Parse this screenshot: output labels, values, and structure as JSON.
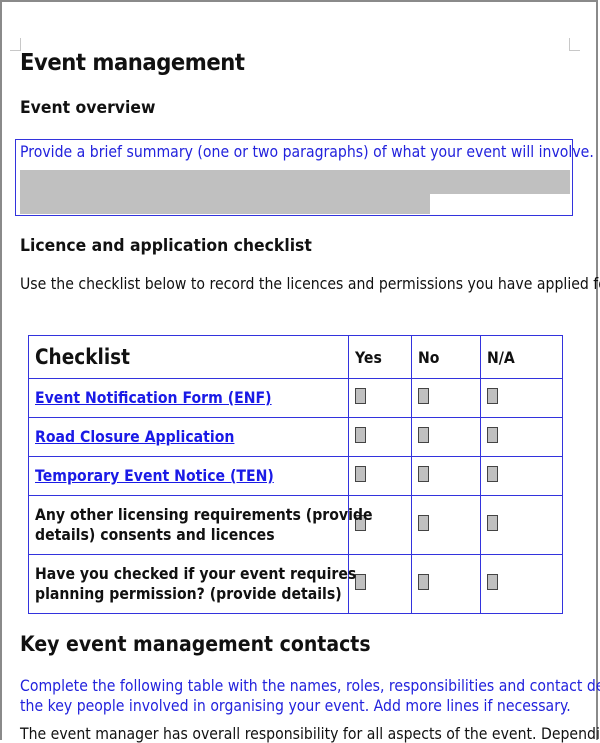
{
  "document": {
    "title": "Event management",
    "overview": {
      "heading": "Event overview",
      "prompt": "Provide a brief summary (one or two paragraphs) of what your event will involve.",
      "field_state": "empty-grey-fill"
    },
    "checklist_section": {
      "heading": "Licence and application checklist",
      "intro": "Use the checklist below to record the licences and permissions you have applied for.",
      "table": {
        "headers": [
          "Checklist",
          "Yes",
          "No",
          "N/A"
        ],
        "rows": [
          {
            "label": "Event Notification Form (ENF)",
            "is_link": true,
            "yes": false,
            "no": false,
            "na": false
          },
          {
            "label": "Road Closure Application",
            "is_link": true,
            "yes": false,
            "no": false,
            "na": false
          },
          {
            "label": "Temporary Event Notice (TEN)",
            "is_link": true,
            "yes": false,
            "no": false,
            "na": false
          },
          {
            "label_line1": "Any other licensing requirements (provide",
            "label_line2": "details) consents and licences",
            "is_link": false,
            "yes": false,
            "no": false,
            "na": false
          },
          {
            "label_line1": "Have you checked if your event requires",
            "label_line2": "planning permission? (provide details)",
            "is_link": false,
            "yes": false,
            "no": false,
            "na": false
          }
        ]
      }
    },
    "contacts_section": {
      "heading": "Key event management contacts",
      "intro_line1": "Complete the following table with the names, roles, responsibilities and contact details of",
      "intro_line2": "the key people involved in organising your event. Add more lines if necessary.",
      "cut_off_text": "The event manager has overall responsibility for all aspects of the event. Depending on"
    }
  },
  "colors": {
    "link": "#1a1ae6",
    "table_border": "#3333dd",
    "instruction_text": "#2222dd",
    "form_field_fill": "#c0c0c0"
  }
}
